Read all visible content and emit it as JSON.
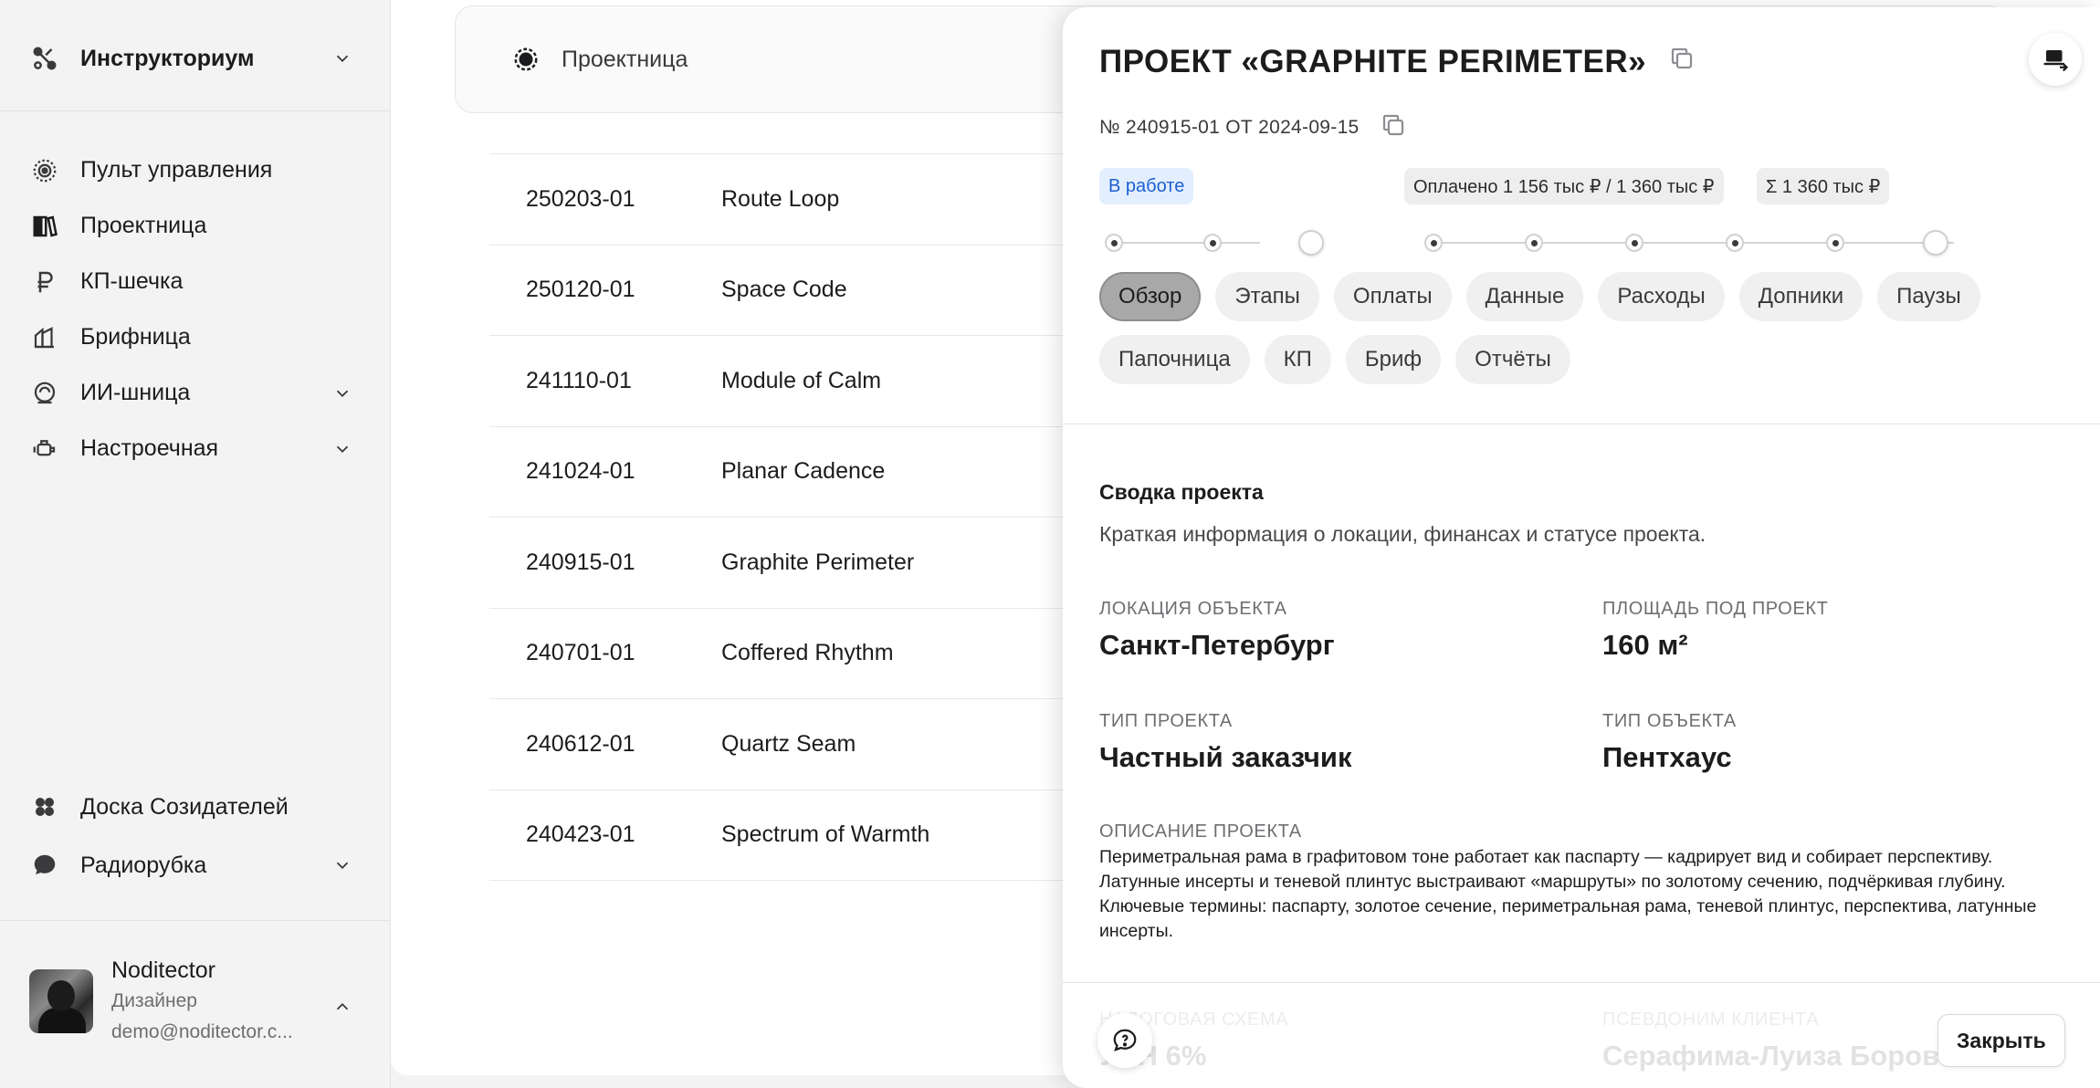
{
  "sidebar": {
    "workspace": "Инструкториум",
    "items": [
      {
        "label": "Пульт управления",
        "icon": "dashboard-icon"
      },
      {
        "label": "Проектница",
        "icon": "books-icon"
      },
      {
        "label": "КП-шечка",
        "icon": "ruble-icon"
      },
      {
        "label": "Брифница",
        "icon": "brief-icon"
      },
      {
        "label": "ИИ-шница",
        "icon": "ai-icon"
      },
      {
        "label": "Настроечная",
        "icon": "settings-icon"
      }
    ],
    "bottom_items": [
      {
        "label": "Доска Созидателей",
        "icon": "clover-icon"
      },
      {
        "label": "Радиорубка",
        "icon": "chat-bubble-icon"
      }
    ],
    "user": {
      "name": "Noditector",
      "role": "Дизайнер",
      "email": "demo@noditector.c..."
    }
  },
  "main": {
    "header_title": "Проектница",
    "rows": [
      {
        "code": "250203-01",
        "name": "Route Loop"
      },
      {
        "code": "250120-01",
        "name": "Space Code"
      },
      {
        "code": "241110-01",
        "name": "Module of Calm"
      },
      {
        "code": "241024-01",
        "name": "Planar Cadence"
      },
      {
        "code": "240915-01",
        "name": "Graphite Perimeter"
      },
      {
        "code": "240701-01",
        "name": "Coffered Rhythm"
      },
      {
        "code": "240612-01",
        "name": "Quartz Seam"
      },
      {
        "code": "240423-01",
        "name": "Spectrum of Warmth"
      }
    ]
  },
  "panel": {
    "title": "ПРОЕКТ «GRAPHITE PERIMETER»",
    "subtitle": "№ 240915-01 ОТ 2024-09-15",
    "status": "В работе",
    "paid": "Оплачено 1 156 тыс ₽ / 1 360 тыс ₽",
    "total": "Σ 1 360 тыс ₽",
    "tabs": [
      "Обзор",
      "Этапы",
      "Оплаты",
      "Данные",
      "Расходы",
      "Допники",
      "Паузы",
      "Папочница",
      "КП",
      "Бриф",
      "Отчёты"
    ],
    "active_tab": "Обзор",
    "summary_title": "Сводка проекта",
    "summary_desc": "Краткая информация о локации, финансах и статусе проекта.",
    "fields": {
      "location_label": "ЛОКАЦИЯ ОБЪЕКТА",
      "location_value": "Санкт-Петербург",
      "area_label": "ПЛОЩАДЬ ПОД ПРОЕКТ",
      "area_value": "160 м²",
      "ptype_label": "ТИП ПРОЕКТА",
      "ptype_value": "Частный заказчик",
      "otype_label": "ТИП ОБЪЕКТА",
      "otype_value": "Пентхаус",
      "desc_label": "ОПИСАНИЕ ПРОЕКТА",
      "desc_line1": "Периметральная рама в графитовом тоне работает как паспарту — кадрирует вид и собирает перспективу. Латунные инсерты и теневой плинтус выстраивают «маршруты» по золотому сечению, подчёркивая глубину.",
      "desc_line2": "Ключевые термины: паспарту, золотое сечение, периметральная рама, теневой плинтус, перспектива, латунные инсерты.",
      "tax_label": "НАЛОГОВАЯ СХЕМА",
      "tax_value": "УСН 6%",
      "client_label": "ПСЕВДОНИМ КЛИЕНТА",
      "client_value": "Серафима-Луиза Боровикова"
    },
    "close_label": "Закрыть"
  }
}
